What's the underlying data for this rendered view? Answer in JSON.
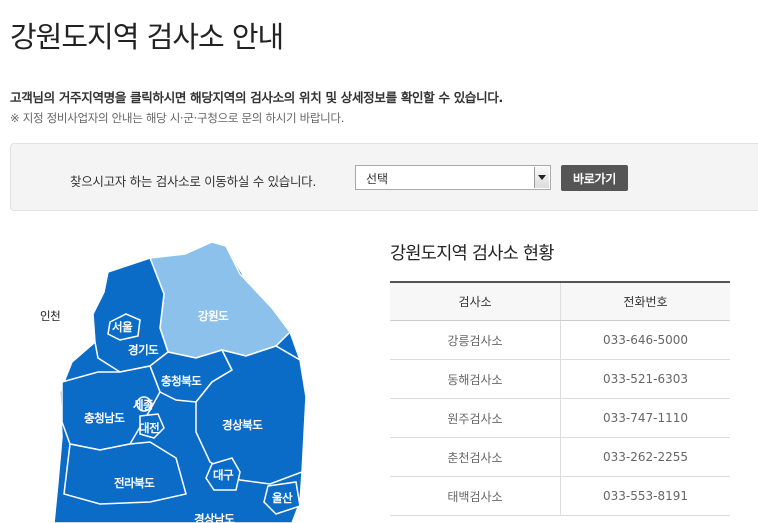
{
  "page": {
    "title": "강원도지역 검사소 안내",
    "intro": "고객님의 거주지역명을 클릭하시면 해당지역의 검사소의 위치 및 상세정보를 확인할 수 있습니다.",
    "note": "※ 지정 정비사업자의 안내는 해당 시·군·구청으로 문의 하시기 바랍니다."
  },
  "search": {
    "label": "찾으시고자 하는 검사소로 이동하실 수 있습니다.",
    "selected": "선택",
    "button_label": "바로가기"
  },
  "map": {
    "regions": {
      "incheon": "인천",
      "seoul": "서울",
      "gyeonggi": "경기도",
      "gangwon": "강원도",
      "chungbuk": "충청북도",
      "sejong": "세종",
      "chungnam": "충청남도",
      "daejeon": "대전",
      "gyeongbuk": "경상북도",
      "jeonbuk": "전라북도",
      "daegu": "대구",
      "ulsan": "울산",
      "gyeongnam": "경상남도"
    },
    "colors": {
      "region": "#0b6cc7",
      "selected_region": "#8cc1ec",
      "border": "#ffffff"
    }
  },
  "status": {
    "title": "강원도지역 검사소 현황",
    "headers": [
      "검사소",
      "전화번호"
    ],
    "rows": [
      {
        "name": "강릉검사소",
        "phone": "033-646-5000"
      },
      {
        "name": "동해검사소",
        "phone": "033-521-6303"
      },
      {
        "name": "원주검사소",
        "phone": "033-747-1110"
      },
      {
        "name": "춘천검사소",
        "phone": "033-262-2255"
      },
      {
        "name": "태백검사소",
        "phone": "033-553-8191"
      }
    ]
  }
}
